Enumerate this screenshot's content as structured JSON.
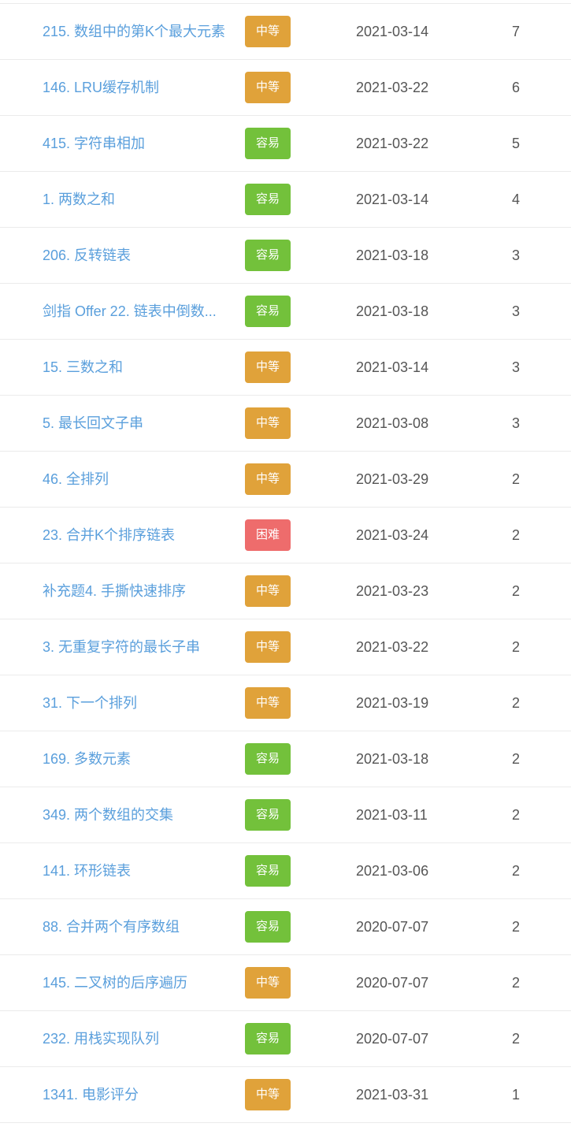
{
  "difficulty_colors": {
    "中等": "#e0a23a",
    "容易": "#73c13b",
    "困难": "#ee6c6c"
  },
  "rows": [
    {
      "title": "215. 数组中的第K个最大元素",
      "difficulty": "中等",
      "date": "2021-03-14",
      "count": "7"
    },
    {
      "title": "146. LRU缓存机制",
      "difficulty": "中等",
      "date": "2021-03-22",
      "count": "6"
    },
    {
      "title": "415. 字符串相加",
      "difficulty": "容易",
      "date": "2021-03-22",
      "count": "5"
    },
    {
      "title": "1. 两数之和",
      "difficulty": "容易",
      "date": "2021-03-14",
      "count": "4"
    },
    {
      "title": "206. 反转链表",
      "difficulty": "容易",
      "date": "2021-03-18",
      "count": "3"
    },
    {
      "title": "剑指 Offer 22. 链表中倒数...",
      "difficulty": "容易",
      "date": "2021-03-18",
      "count": "3"
    },
    {
      "title": "15. 三数之和",
      "difficulty": "中等",
      "date": "2021-03-14",
      "count": "3"
    },
    {
      "title": "5. 最长回文子串",
      "difficulty": "中等",
      "date": "2021-03-08",
      "count": "3"
    },
    {
      "title": "46. 全排列",
      "difficulty": "中等",
      "date": "2021-03-29",
      "count": "2"
    },
    {
      "title": "23. 合并K个排序链表",
      "difficulty": "困难",
      "date": "2021-03-24",
      "count": "2"
    },
    {
      "title": "补充题4. 手撕快速排序",
      "difficulty": "中等",
      "date": "2021-03-23",
      "count": "2"
    },
    {
      "title": "3. 无重复字符的最长子串",
      "difficulty": "中等",
      "date": "2021-03-22",
      "count": "2"
    },
    {
      "title": "31. 下一个排列",
      "difficulty": "中等",
      "date": "2021-03-19",
      "count": "2"
    },
    {
      "title": "169. 多数元素",
      "difficulty": "容易",
      "date": "2021-03-18",
      "count": "2"
    },
    {
      "title": "349. 两个数组的交集",
      "difficulty": "容易",
      "date": "2021-03-11",
      "count": "2"
    },
    {
      "title": "141. 环形链表",
      "difficulty": "容易",
      "date": "2021-03-06",
      "count": "2"
    },
    {
      "title": "88. 合并两个有序数组",
      "difficulty": "容易",
      "date": "2020-07-07",
      "count": "2"
    },
    {
      "title": "145. 二叉树的后序遍历",
      "difficulty": "中等",
      "date": "2020-07-07",
      "count": "2"
    },
    {
      "title": "232. 用栈实现队列",
      "difficulty": "容易",
      "date": "2020-07-07",
      "count": "2"
    },
    {
      "title": "1341. 电影评分",
      "difficulty": "中等",
      "date": "2021-03-31",
      "count": "1"
    }
  ]
}
